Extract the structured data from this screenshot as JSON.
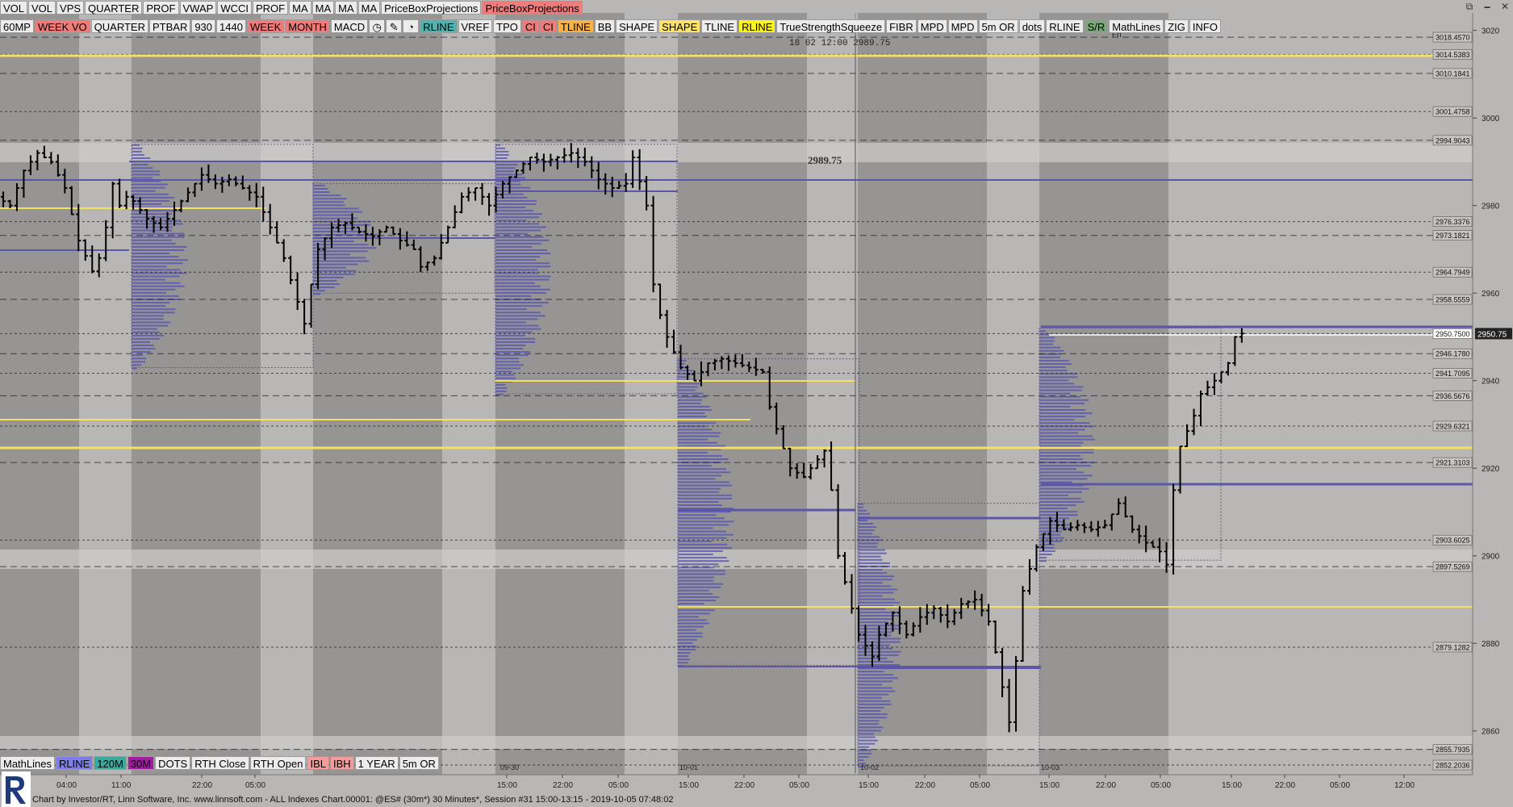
{
  "toolbar_top": [
    {
      "label": "VOL",
      "style": ""
    },
    {
      "label": "VOL",
      "style": ""
    },
    {
      "label": "VPS",
      "style": ""
    },
    {
      "label": "QUARTER",
      "style": ""
    },
    {
      "label": "PROF",
      "style": ""
    },
    {
      "label": "VWAP",
      "style": ""
    },
    {
      "label": "WCCI",
      "style": ""
    },
    {
      "label": "PROF",
      "style": ""
    },
    {
      "label": "MA",
      "style": ""
    },
    {
      "label": "MA",
      "style": ""
    },
    {
      "label": "MA",
      "style": ""
    },
    {
      "label": "MA",
      "style": ""
    },
    {
      "label": "PriceBoxProjections",
      "style": ""
    },
    {
      "label": "PriceBoxProjections",
      "style": "red"
    }
  ],
  "toolbar_second": [
    {
      "label": "60MP",
      "style": ""
    },
    {
      "label": "WEEK VO",
      "style": "red"
    },
    {
      "label": "QUARTER",
      "style": ""
    },
    {
      "label": "PTBAR",
      "style": ""
    },
    {
      "label": "930",
      "style": ""
    },
    {
      "label": "1440",
      "style": ""
    },
    {
      "label": "WEEK",
      "style": "red"
    },
    {
      "label": "MONTH",
      "style": "red"
    },
    {
      "label": "MACD",
      "style": ""
    },
    {
      "label": "◷",
      "style": "icon",
      "name": "clock-icon"
    },
    {
      "label": "✎",
      "style": "icon",
      "name": "pencil-icon"
    },
    {
      "label": "◔",
      "style": "icon",
      "name": "drop-icon"
    },
    {
      "label": "RLINE",
      "style": "teal"
    },
    {
      "label": "VREF",
      "style": ""
    },
    {
      "label": "TPO",
      "style": ""
    },
    {
      "label": "CI",
      "style": "red"
    },
    {
      "label": "CI",
      "style": "red"
    },
    {
      "label": "TLINE",
      "style": "orange"
    },
    {
      "label": "BB",
      "style": ""
    },
    {
      "label": "SHAPE",
      "style": ""
    },
    {
      "label": "SHAPE",
      "style": "ygold"
    },
    {
      "label": "TLINE",
      "style": ""
    },
    {
      "label": "RLINE",
      "style": "yellow"
    },
    {
      "label": "TrueStrengthSqueeze",
      "style": ""
    },
    {
      "label": "FIBR",
      "style": ""
    },
    {
      "label": "MPD",
      "style": ""
    },
    {
      "label": "MPD",
      "style": ""
    },
    {
      "label": "5m OR",
      "style": ""
    },
    {
      "label": "dots",
      "style": ""
    },
    {
      "label": "RLINE",
      "style": ""
    },
    {
      "label": "S/R",
      "style": "green"
    },
    {
      "label": "MathLines",
      "style": ""
    },
    {
      "label": "ZIG",
      "style": ""
    },
    {
      "label": "INFO",
      "style": ""
    }
  ],
  "toolbar_bottom": [
    {
      "label": "MathLines",
      "style": ""
    },
    {
      "label": "RLINE",
      "style": "blue"
    },
    {
      "label": "120M",
      "style": "tealg"
    },
    {
      "label": "30M",
      "style": "purple"
    },
    {
      "label": "DOTS",
      "style": ""
    },
    {
      "label": "RTH Close",
      "style": ""
    },
    {
      "label": "RTH Open",
      "style": ""
    },
    {
      "label": "IBL",
      "style": "pink"
    },
    {
      "label": "IBH",
      "style": "pink"
    },
    {
      "label": "1 YEAR",
      "style": ""
    },
    {
      "label": "5m OR",
      "style": ""
    }
  ],
  "window_controls": [
    "⧉",
    "🗕",
    "✕"
  ],
  "crosshair_readout": "18  02 12:00  2989.75",
  "day_label": "Fri",
  "center_price_label": "2989.75",
  "status_text": "Chart by Investor/RT, Linn Software, Inc. www.linnsoft.com - ALL Indexes Chart.00001: @ES# (30m*) 30 Minutes*, Session #31 15:00-13:15 - 2019-10-05 07:48:02",
  "colors": {
    "background": "#b9b7b6",
    "session_dark": "#979594",
    "poc_line": "#5b56a8",
    "yellow_line": "#f6e05e",
    "profile": "#5552b5",
    "candle": "#000000"
  },
  "chart_data": {
    "type": "candlestick",
    "instrument": "@ES#",
    "interval": "30 Minutes",
    "price_axis": {
      "range": [
        2850,
        3024
      ],
      "ticks": [
        3020,
        3000,
        2980,
        2960,
        2940,
        2920,
        2900,
        2880,
        2860
      ]
    },
    "time_axis": {
      "ticks": [
        "04:00",
        "11:00",
        "22:00",
        "05:00",
        "15:00",
        "22:00",
        "05:00",
        "15:00",
        "22:00",
        "05:00",
        "15:00",
        "22:00",
        "05:00",
        "15:00",
        "22:00",
        "05:00",
        "15:00",
        "22:00",
        "05:00",
        "12:00"
      ],
      "date_labels": [
        "09-30",
        "10-01",
        "10-02",
        "10-03"
      ]
    },
    "price_labels": [
      "3018.4570",
      "3014.5383",
      "3010.1841",
      "3001.4758",
      "2994.9043",
      "2976.3376",
      "2973.1821",
      "2964.7949",
      "2958.5559",
      "2950.7500",
      "2946.1780",
      "2941.7095",
      "2936.5676",
      "2929.6321",
      "2921.3103",
      "2903.6025",
      "2897.5269",
      "2879.1282",
      "2855.7935",
      "2852.2036"
    ],
    "current_price": "2950.75",
    "last_close": 2950.75,
    "path_points": [
      [
        0,
        2982
      ],
      [
        2,
        2980
      ],
      [
        4,
        2988
      ],
      [
        6,
        2992
      ],
      [
        8,
        2990
      ],
      [
        10,
        2984
      ],
      [
        12,
        2972
      ],
      [
        14,
        2965
      ],
      [
        15,
        2968
      ],
      [
        16,
        2975
      ],
      [
        17,
        2985
      ],
      [
        18,
        2980
      ],
      [
        19,
        2982
      ],
      [
        20,
        2981
      ],
      [
        22,
        2977
      ],
      [
        24,
        2975
      ],
      [
        26,
        2979
      ],
      [
        28,
        2983
      ],
      [
        30,
        2987
      ],
      [
        32,
        2985
      ],
      [
        34,
        2986
      ],
      [
        36,
        2984
      ],
      [
        38,
        2982
      ],
      [
        40,
        2975
      ],
      [
        42,
        2968
      ],
      [
        44,
        2958
      ],
      [
        45,
        2953
      ],
      [
        46,
        2962
      ],
      [
        47,
        2970
      ],
      [
        49,
        2975
      ],
      [
        51,
        2976
      ],
      [
        53,
        2974
      ],
      [
        55,
        2973
      ],
      [
        57,
        2975
      ],
      [
        59,
        2972
      ],
      [
        61,
        2970
      ],
      [
        62,
        2966
      ],
      [
        64,
        2968
      ],
      [
        66,
        2975
      ],
      [
        68,
        2982
      ],
      [
        70,
        2984
      ],
      [
        72,
        2980
      ],
      [
        74,
        2985
      ],
      [
        76,
        2988
      ],
      [
        78,
        2991
      ],
      [
        80,
        2990
      ],
      [
        82,
        2991
      ],
      [
        84,
        2992
      ],
      [
        86,
        2990
      ],
      [
        88,
        2986
      ],
      [
        90,
        2984
      ],
      [
        92,
        2985
      ],
      [
        93,
        2991
      ],
      [
        95,
        2980
      ],
      [
        96,
        2962
      ],
      [
        97,
        2955
      ],
      [
        98,
        2950
      ],
      [
        100,
        2943
      ],
      [
        102,
        2940
      ],
      [
        104,
        2944
      ],
      [
        106,
        2945
      ],
      [
        108,
        2944
      ],
      [
        110,
        2943
      ],
      [
        112,
        2942
      ],
      [
        113,
        2934
      ],
      [
        114,
        2929
      ],
      [
        116,
        2920
      ],
      [
        118,
        2918
      ],
      [
        120,
        2922
      ],
      [
        121,
        2924
      ],
      [
        122,
        2915
      ],
      [
        123,
        2900
      ],
      [
        125,
        2888
      ],
      [
        126,
        2882
      ],
      [
        128,
        2877
      ],
      [
        129,
        2882
      ],
      [
        131,
        2887
      ],
      [
        133,
        2882
      ],
      [
        135,
        2886
      ],
      [
        137,
        2888
      ],
      [
        139,
        2885
      ],
      [
        141,
        2889
      ],
      [
        143,
        2890
      ],
      [
        145,
        2885
      ],
      [
        146,
        2878
      ],
      [
        147,
        2870
      ],
      [
        148,
        2862
      ],
      [
        149,
        2876
      ],
      [
        150,
        2892
      ],
      [
        152,
        2902
      ],
      [
        154,
        2908
      ],
      [
        156,
        2906
      ],
      [
        158,
        2907
      ],
      [
        160,
        2906
      ],
      [
        162,
        2907
      ],
      [
        164,
        2912
      ],
      [
        166,
        2906
      ],
      [
        168,
        2903
      ],
      [
        170,
        2901
      ],
      [
        171,
        2898
      ],
      [
        172,
        2915
      ],
      [
        173,
        2925
      ],
      [
        175,
        2932
      ],
      [
        176,
        2937
      ],
      [
        178,
        2940
      ],
      [
        180,
        2944
      ],
      [
        181,
        2950
      ],
      [
        182,
        2950.75
      ]
    ]
  }
}
